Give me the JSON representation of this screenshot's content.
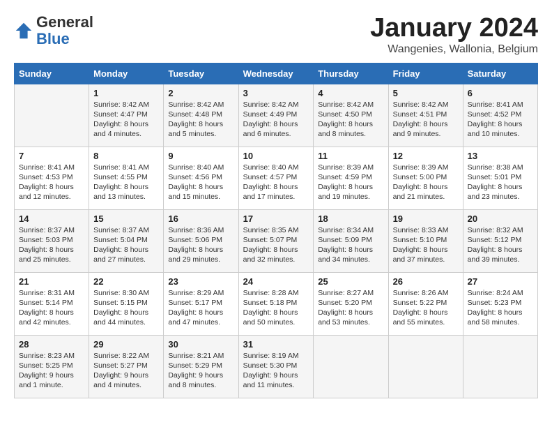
{
  "header": {
    "logo_general": "General",
    "logo_blue": "Blue",
    "month_title": "January 2024",
    "subtitle": "Wangenies, Wallonia, Belgium"
  },
  "days_of_week": [
    "Sunday",
    "Monday",
    "Tuesday",
    "Wednesday",
    "Thursday",
    "Friday",
    "Saturday"
  ],
  "weeks": [
    [
      {
        "day": "",
        "content": ""
      },
      {
        "day": "1",
        "content": "Sunrise: 8:42 AM\nSunset: 4:47 PM\nDaylight: 8 hours\nand 4 minutes."
      },
      {
        "day": "2",
        "content": "Sunrise: 8:42 AM\nSunset: 4:48 PM\nDaylight: 8 hours\nand 5 minutes."
      },
      {
        "day": "3",
        "content": "Sunrise: 8:42 AM\nSunset: 4:49 PM\nDaylight: 8 hours\nand 6 minutes."
      },
      {
        "day": "4",
        "content": "Sunrise: 8:42 AM\nSunset: 4:50 PM\nDaylight: 8 hours\nand 8 minutes."
      },
      {
        "day": "5",
        "content": "Sunrise: 8:42 AM\nSunset: 4:51 PM\nDaylight: 8 hours\nand 9 minutes."
      },
      {
        "day": "6",
        "content": "Sunrise: 8:41 AM\nSunset: 4:52 PM\nDaylight: 8 hours\nand 10 minutes."
      }
    ],
    [
      {
        "day": "7",
        "content": "Sunrise: 8:41 AM\nSunset: 4:53 PM\nDaylight: 8 hours\nand 12 minutes."
      },
      {
        "day": "8",
        "content": "Sunrise: 8:41 AM\nSunset: 4:55 PM\nDaylight: 8 hours\nand 13 minutes."
      },
      {
        "day": "9",
        "content": "Sunrise: 8:40 AM\nSunset: 4:56 PM\nDaylight: 8 hours\nand 15 minutes."
      },
      {
        "day": "10",
        "content": "Sunrise: 8:40 AM\nSunset: 4:57 PM\nDaylight: 8 hours\nand 17 minutes."
      },
      {
        "day": "11",
        "content": "Sunrise: 8:39 AM\nSunset: 4:59 PM\nDaylight: 8 hours\nand 19 minutes."
      },
      {
        "day": "12",
        "content": "Sunrise: 8:39 AM\nSunset: 5:00 PM\nDaylight: 8 hours\nand 21 minutes."
      },
      {
        "day": "13",
        "content": "Sunrise: 8:38 AM\nSunset: 5:01 PM\nDaylight: 8 hours\nand 23 minutes."
      }
    ],
    [
      {
        "day": "14",
        "content": "Sunrise: 8:37 AM\nSunset: 5:03 PM\nDaylight: 8 hours\nand 25 minutes."
      },
      {
        "day": "15",
        "content": "Sunrise: 8:37 AM\nSunset: 5:04 PM\nDaylight: 8 hours\nand 27 minutes."
      },
      {
        "day": "16",
        "content": "Sunrise: 8:36 AM\nSunset: 5:06 PM\nDaylight: 8 hours\nand 29 minutes."
      },
      {
        "day": "17",
        "content": "Sunrise: 8:35 AM\nSunset: 5:07 PM\nDaylight: 8 hours\nand 32 minutes."
      },
      {
        "day": "18",
        "content": "Sunrise: 8:34 AM\nSunset: 5:09 PM\nDaylight: 8 hours\nand 34 minutes."
      },
      {
        "day": "19",
        "content": "Sunrise: 8:33 AM\nSunset: 5:10 PM\nDaylight: 8 hours\nand 37 minutes."
      },
      {
        "day": "20",
        "content": "Sunrise: 8:32 AM\nSunset: 5:12 PM\nDaylight: 8 hours\nand 39 minutes."
      }
    ],
    [
      {
        "day": "21",
        "content": "Sunrise: 8:31 AM\nSunset: 5:14 PM\nDaylight: 8 hours\nand 42 minutes."
      },
      {
        "day": "22",
        "content": "Sunrise: 8:30 AM\nSunset: 5:15 PM\nDaylight: 8 hours\nand 44 minutes."
      },
      {
        "day": "23",
        "content": "Sunrise: 8:29 AM\nSunset: 5:17 PM\nDaylight: 8 hours\nand 47 minutes."
      },
      {
        "day": "24",
        "content": "Sunrise: 8:28 AM\nSunset: 5:18 PM\nDaylight: 8 hours\nand 50 minutes."
      },
      {
        "day": "25",
        "content": "Sunrise: 8:27 AM\nSunset: 5:20 PM\nDaylight: 8 hours\nand 53 minutes."
      },
      {
        "day": "26",
        "content": "Sunrise: 8:26 AM\nSunset: 5:22 PM\nDaylight: 8 hours\nand 55 minutes."
      },
      {
        "day": "27",
        "content": "Sunrise: 8:24 AM\nSunset: 5:23 PM\nDaylight: 8 hours\nand 58 minutes."
      }
    ],
    [
      {
        "day": "28",
        "content": "Sunrise: 8:23 AM\nSunset: 5:25 PM\nDaylight: 9 hours\nand 1 minute."
      },
      {
        "day": "29",
        "content": "Sunrise: 8:22 AM\nSunset: 5:27 PM\nDaylight: 9 hours\nand 4 minutes."
      },
      {
        "day": "30",
        "content": "Sunrise: 8:21 AM\nSunset: 5:29 PM\nDaylight: 9 hours\nand 8 minutes."
      },
      {
        "day": "31",
        "content": "Sunrise: 8:19 AM\nSunset: 5:30 PM\nDaylight: 9 hours\nand 11 minutes."
      },
      {
        "day": "",
        "content": ""
      },
      {
        "day": "",
        "content": ""
      },
      {
        "day": "",
        "content": ""
      }
    ]
  ]
}
